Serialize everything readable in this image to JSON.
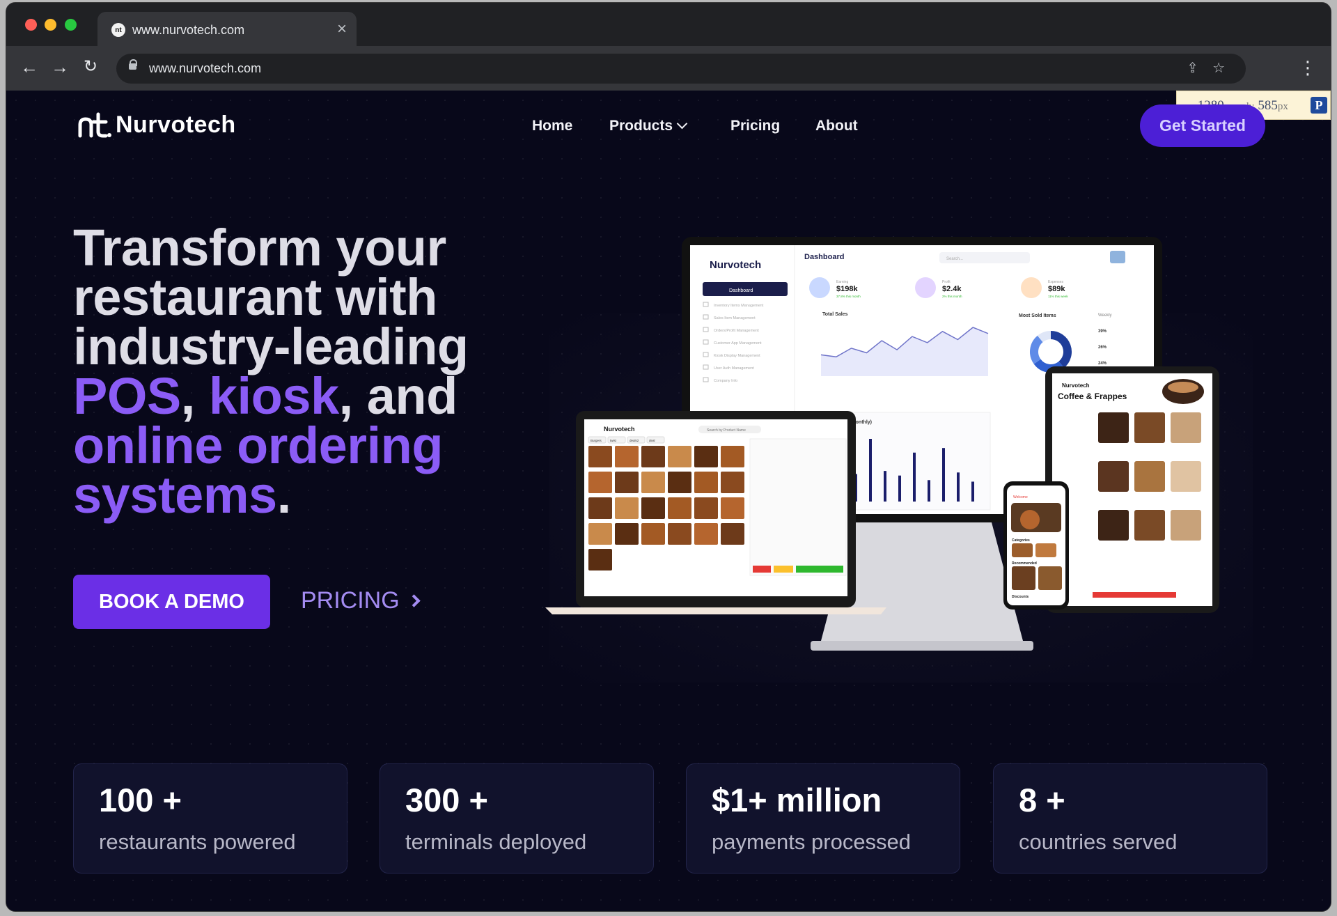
{
  "browser": {
    "tab_title": "www.nurvotech.com",
    "url": "www.nurvotech.com",
    "favicon": "nurvotech-logo-icon"
  },
  "size_overlay": {
    "w_label": "w:",
    "w_value": "1280",
    "h_label": "h:",
    "h_value": "585",
    "unit": "px"
  },
  "header": {
    "logo_text": "Nurvotech",
    "nav": {
      "home": "Home",
      "products": "Products",
      "pricing": "Pricing",
      "about": "About"
    },
    "cta": "Get Started"
  },
  "hero": {
    "line1": "Transform your",
    "line2": "restaurant with",
    "line3": "industry-leading",
    "pos": "POS",
    "comma1": ", ",
    "kiosk": "kiosk",
    "and": ", and",
    "online_ordering": "online ordering",
    "systems": "systems",
    "period": ".",
    "book_demo": "BOOK A DEMO",
    "pricing_link": "PRICING"
  },
  "mockups": {
    "monitor": {
      "brand": "Nurvotech",
      "title": "Dashboard",
      "search": "Search...",
      "sidebar_active": "Dashboard",
      "sidebar_items": [
        "Inventory Items Management",
        "Sales Item Management",
        "Orders/Profit Management",
        "Customer App Management",
        "Kiosk Display Management",
        "User Auth Management",
        "Company Info"
      ],
      "kpis": [
        {
          "label": "Earning",
          "value": "$198k",
          "delta": "37.8% this month"
        },
        {
          "label": "Profit",
          "value": "$2.4k",
          "delta": "2% this month"
        },
        {
          "label": "Expenses",
          "value": "$89k",
          "delta": "11% this week"
        }
      ],
      "total_sales": "Total Sales",
      "most_sold": "Most Sold Items",
      "weekly": "Weekly",
      "total_orders": "Total Orders(monthly)",
      "donut_pcts": [
        "39%",
        "26%",
        "24%"
      ],
      "line_series": [
        42,
        38,
        55,
        46,
        70,
        52,
        78,
        66,
        88,
        72,
        96,
        84
      ],
      "bar_series": [
        30,
        48,
        36,
        82,
        40,
        34,
        64,
        28,
        70,
        38,
        26
      ]
    },
    "laptop": {
      "brand": "Nurvotech",
      "search": "Search by Product Name",
      "categories": [
        "Burgers",
        "twist",
        "deals2",
        "deal"
      ]
    },
    "tablet": {
      "brand": "Nurvotech",
      "heading": "Coffee & Frappes"
    },
    "phone": {
      "welcome": "Welcome",
      "section1": "Categories",
      "section2": "Recommended",
      "section3": "Discounts"
    }
  },
  "stats": [
    {
      "value": "100 +",
      "label": "restaurants powered"
    },
    {
      "value": "300 +",
      "label": "terminals deployed"
    },
    {
      "value": "$1+ million",
      "label": "payments processed"
    },
    {
      "value": "8 +",
      "label": "countries served"
    }
  ],
  "colors": {
    "page_bg": "#08081a",
    "accent": "#8b5cf6",
    "cta": "#4c1fd6",
    "book_demo": "#6b2fe6",
    "card_bg": "#11122c"
  }
}
